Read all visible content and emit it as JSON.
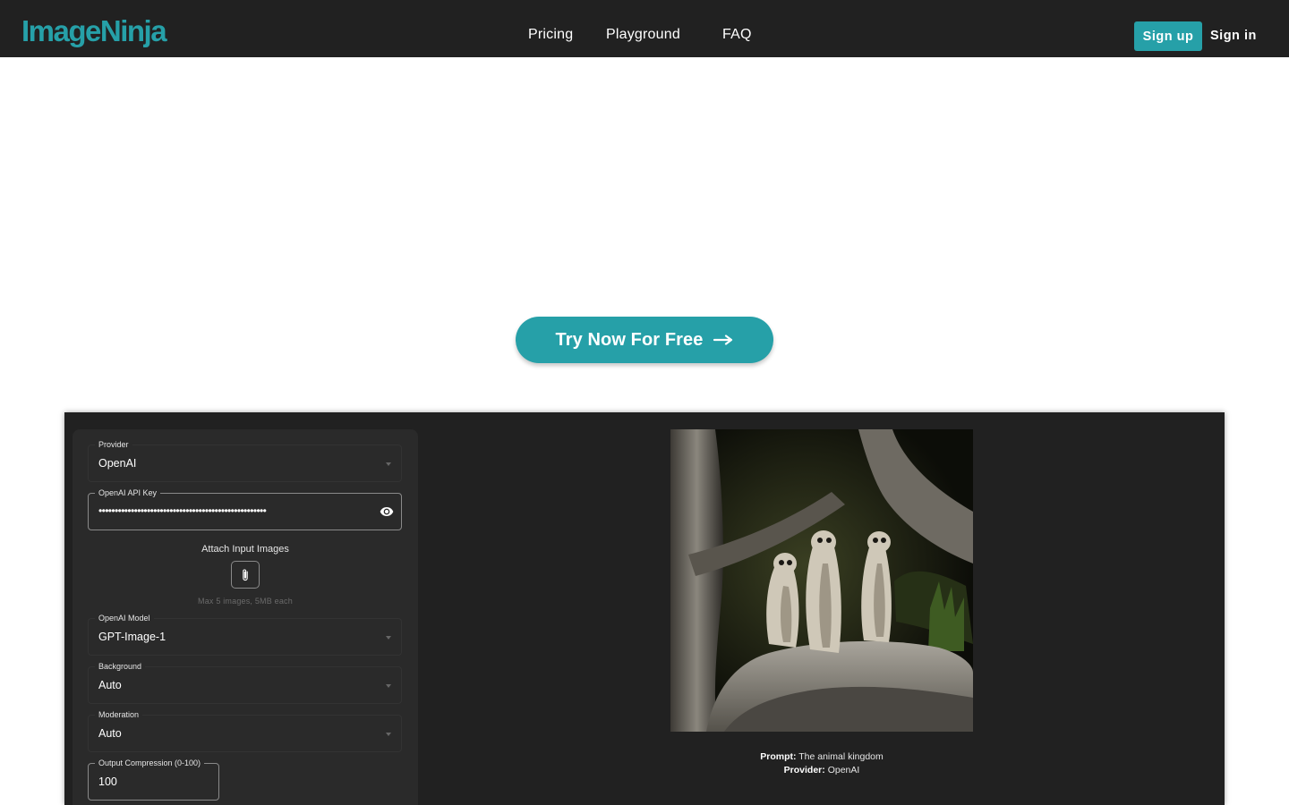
{
  "header": {
    "logo": "ImageNinja",
    "nav": {
      "pricing": "Pricing",
      "playground": "Playground",
      "faq": "FAQ"
    },
    "signup_label": "Sign up",
    "signin_label": "Sign in"
  },
  "hero": {
    "cta_label": "Try Now For Free",
    "cta_icon": "arrow-right-icon"
  },
  "playground": {
    "provider": {
      "label": "Provider",
      "value": "OpenAI",
      "icon": "caret-down-icon"
    },
    "api_key": {
      "label": "OpenAI API Key",
      "masked_value": "••••••••••••••••••••••••••••••••••••••••••••••••••••",
      "icon": "eye-icon"
    },
    "attach": {
      "title": "Attach Input Images",
      "icon": "paperclip-icon",
      "hint": "Max 5 images, 5MB each"
    },
    "model": {
      "label": "OpenAI Model",
      "value": "GPT-Image-1"
    },
    "background": {
      "label": "Background",
      "value": "Auto"
    },
    "moderation": {
      "label": "Moderation",
      "value": "Auto"
    },
    "compression": {
      "label": "Output Compression (0-100)",
      "value": "100"
    },
    "preview": {
      "image_alt": "Three meerkats standing on a rock under a tree",
      "prompt_label": "Prompt:",
      "prompt_value": "The animal kingdom",
      "provider_label": "Provider:",
      "provider_value": "OpenAI"
    }
  },
  "colors": {
    "brand": "#26a0a8",
    "header_bg": "#212121",
    "panel_bg": "#212121",
    "form_bg": "#2a2a2a"
  }
}
